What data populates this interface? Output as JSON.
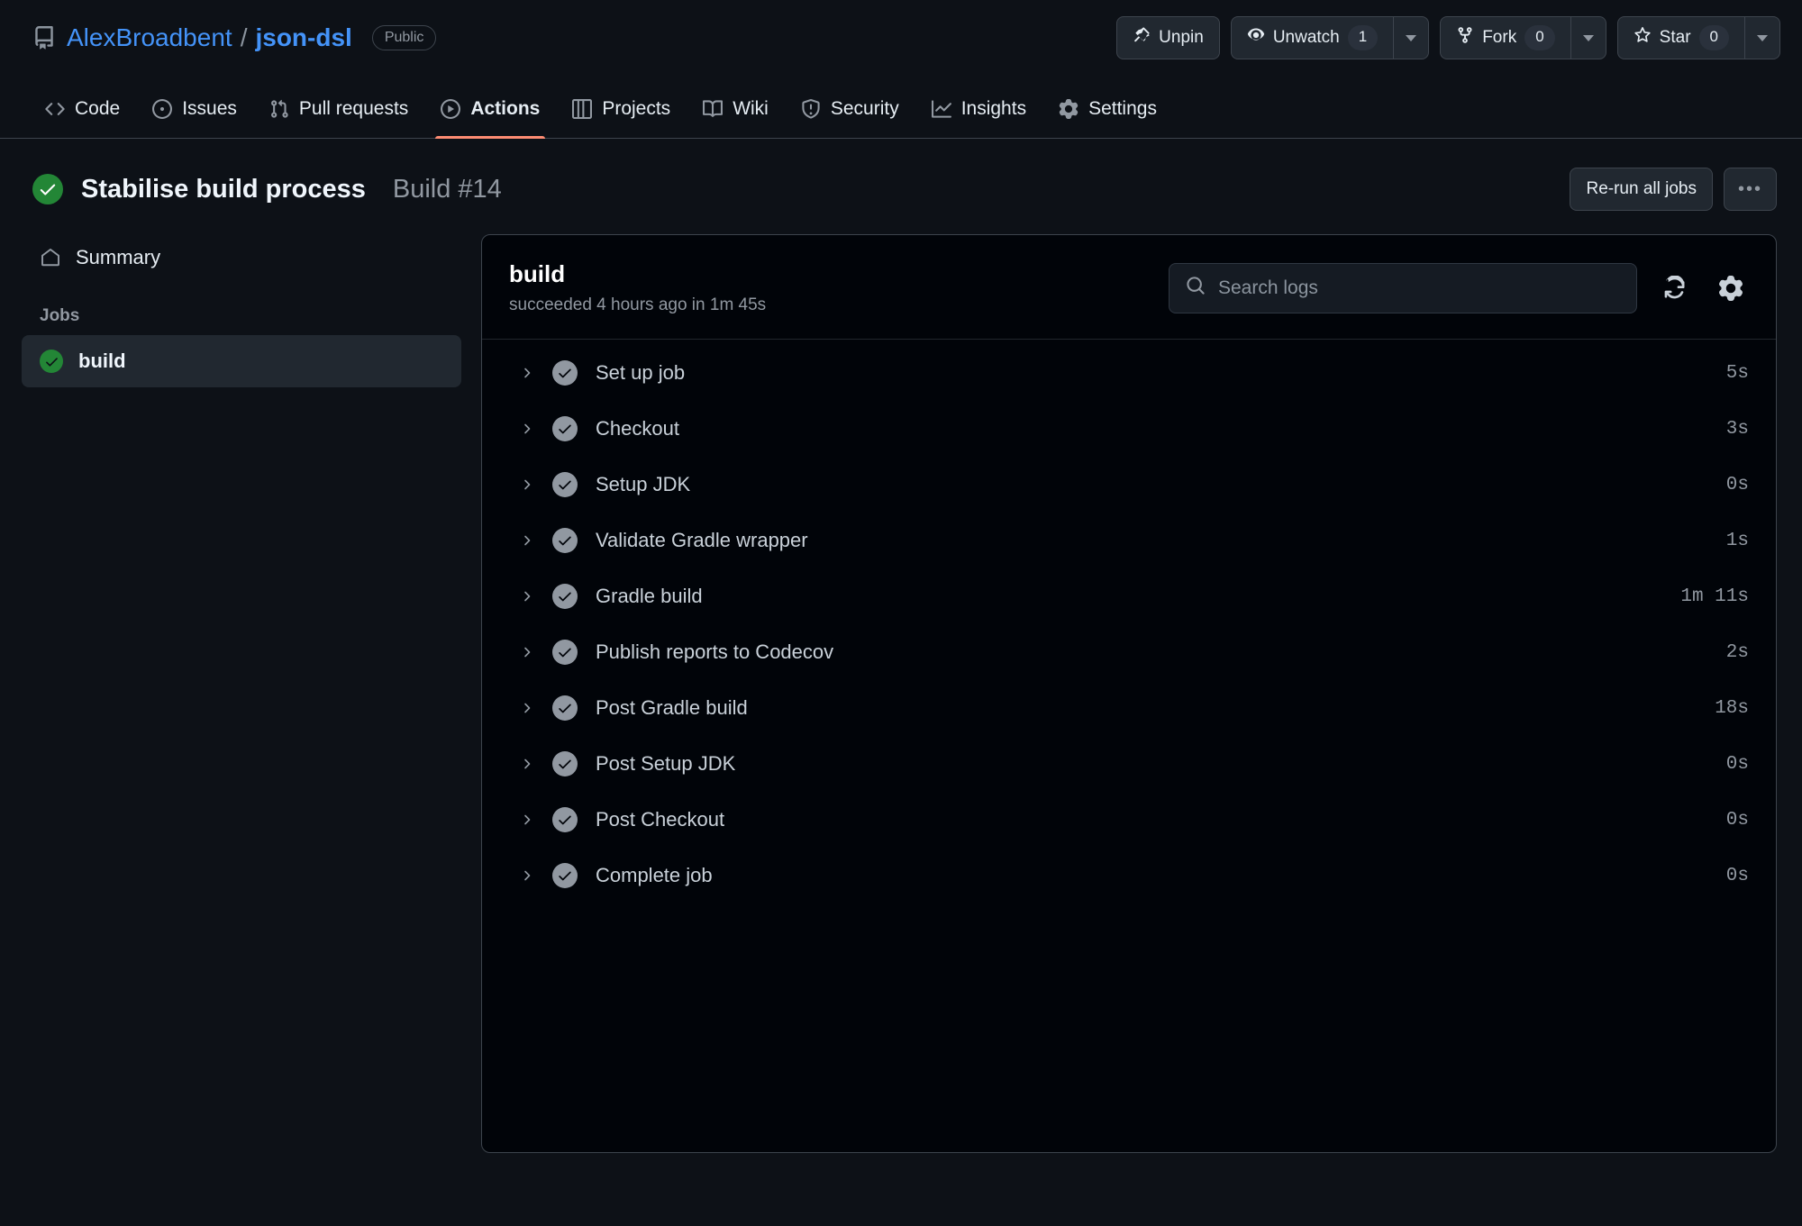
{
  "repo": {
    "icon": "repo-icon",
    "owner": "AlexBroadbent",
    "separator": "/",
    "name": "json-dsl",
    "visibility": "Public",
    "actions": {
      "unpin": "Unpin",
      "unwatch": "Unwatch",
      "unwatch_count": "1",
      "fork": "Fork",
      "fork_count": "0",
      "star": "Star",
      "star_count": "0"
    }
  },
  "nav": {
    "tabs": [
      {
        "label": "Code",
        "icon": "code-icon",
        "active": false
      },
      {
        "label": "Issues",
        "icon": "issue-opened-icon",
        "active": false
      },
      {
        "label": "Pull requests",
        "icon": "git-pull-request-icon",
        "active": false
      },
      {
        "label": "Actions",
        "icon": "play-icon",
        "active": true
      },
      {
        "label": "Projects",
        "icon": "project-icon",
        "active": false
      },
      {
        "label": "Wiki",
        "icon": "book-icon",
        "active": false
      },
      {
        "label": "Security",
        "icon": "shield-icon",
        "active": false
      },
      {
        "label": "Insights",
        "icon": "graph-icon",
        "active": false
      },
      {
        "label": "Settings",
        "icon": "gear-icon",
        "active": false
      }
    ]
  },
  "run": {
    "status": "success",
    "title": "Stabilise build process",
    "number": "Build #14",
    "rerun_label": "Re-run all jobs",
    "kebab_label": "•••"
  },
  "sidebar": {
    "summary_label": "Summary",
    "jobs_label": "Jobs",
    "jobs": [
      {
        "name": "build",
        "status": "success",
        "selected": true
      }
    ]
  },
  "log": {
    "job_name": "build",
    "job_subtitle": "succeeded 4 hours ago in 1m 45s",
    "search_placeholder": "Search logs",
    "search_value": "",
    "steps": [
      {
        "name": "Set up job",
        "duration": "5s",
        "status": "success"
      },
      {
        "name": "Checkout",
        "duration": "3s",
        "status": "success"
      },
      {
        "name": "Setup JDK",
        "duration": "0s",
        "status": "success"
      },
      {
        "name": "Validate Gradle wrapper",
        "duration": "1s",
        "status": "success"
      },
      {
        "name": "Gradle build",
        "duration": "1m 11s",
        "status": "success"
      },
      {
        "name": "Publish reports to Codecov",
        "duration": "2s",
        "status": "success"
      },
      {
        "name": "Post Gradle build",
        "duration": "18s",
        "status": "success"
      },
      {
        "name": "Post Setup JDK",
        "duration": "0s",
        "status": "success"
      },
      {
        "name": "Post Checkout",
        "duration": "0s",
        "status": "success"
      },
      {
        "name": "Complete job",
        "duration": "0s",
        "status": "success"
      }
    ]
  },
  "colors": {
    "page_bg": "#0d1117",
    "panel_bg": "#010409",
    "accent_link": "#4493f8",
    "success_green": "#238636",
    "active_tab_underline": "#fd8c73",
    "muted_text": "#9198a1"
  }
}
